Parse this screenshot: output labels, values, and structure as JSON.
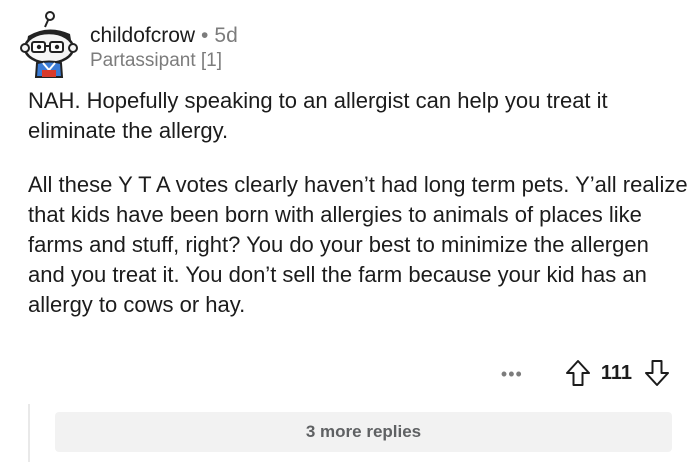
{
  "comment": {
    "author": "childofcrow",
    "separator": "•",
    "age": "5d",
    "flair": "Partassipant [1]",
    "paragraphs": [
      "NAH. Hopefully speaking to an allergist can help you treat it eliminate the allergy.",
      "All these Y T A votes clearly haven’t had long term pets. Y’all realize that kids have been born with allergies to animals of places like farms and stuff, right? You do your best to minimize the allergen and you treat it. You don’t sell the farm because your kid has an allergy to cows or hay."
    ],
    "more_options": "•••",
    "vote_count": "111",
    "more_replies_label": "3 more replies"
  },
  "colors": {
    "text": "#1c1c1c",
    "meta": "#7c7c7c",
    "reply_bg": "#f2f2f2"
  },
  "icons": [
    "user-avatar",
    "upvote-arrow-icon",
    "downvote-arrow-icon",
    "more-options-icon"
  ]
}
